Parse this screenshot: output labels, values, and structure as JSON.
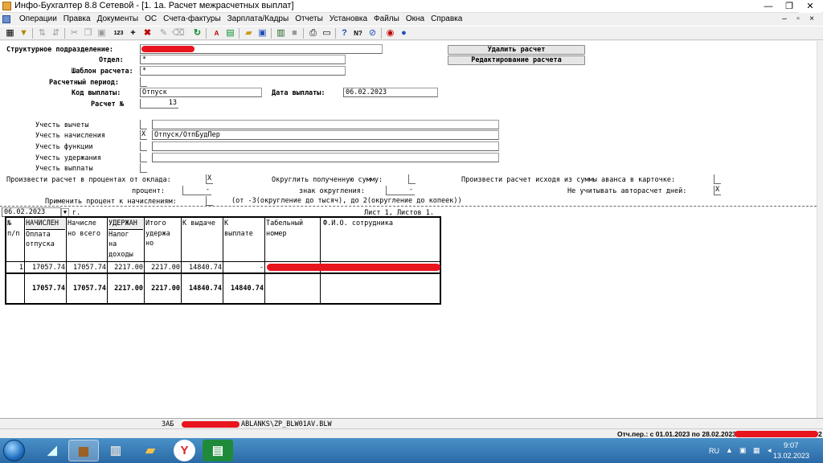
{
  "window": {
    "title": "Инфо-Бухгалтер 8.8 Сетевой - [1. 1а. Расчет межрасчетных выплат]",
    "minimize": "—",
    "restore": "❐",
    "close": "✕",
    "doc_minimize": "–",
    "doc_restore": "▫",
    "doc_close": "×"
  },
  "menu": {
    "items": [
      "Операции",
      "Правка",
      "Документы",
      "ОС",
      "Счета-фактуры",
      "Зарплата/Кадры",
      "Отчеты",
      "Установка",
      "Файлы",
      "Окна",
      "Справка"
    ]
  },
  "toolbar": {
    "icons": [
      "grid-icon",
      "filter-icon",
      "sort-icon",
      "sort-desc-icon",
      "cut-icon",
      "copy-icon",
      "paste-icon",
      "numbering-icon",
      "add-icon",
      "delete-icon",
      "clear-icon",
      "wipe-icon",
      "refresh-icon",
      "pdf-icon",
      "excel-icon",
      "open-folder-icon",
      "save-icon",
      "calculator-icon",
      "stop-icon",
      "print-icon",
      "preview-icon",
      "help-icon",
      "help-context-icon",
      "compass-icon",
      "lifebuoy-icon",
      "user-search-icon"
    ]
  },
  "form": {
    "structural_unit_label": "Структурное подразделение:",
    "department_label": "Отдел:",
    "department_value": "*",
    "template_label": "Шаблон расчета:",
    "template_value": "*",
    "period_label": "Расчетный период:",
    "payment_code_label": "Код выплаты:",
    "payment_code_value": "Отпуск",
    "payment_date_label": "Дата выплаты:",
    "payment_date_value": "06.02.2023",
    "calc_number_label": "Расчет №",
    "calc_number_value": "13",
    "delete_button": "Удалить расчет",
    "edit_button": "Редактирование расчета",
    "consider_deductions": "Учесть вычеты",
    "consider_accruals": "Учесть начисления",
    "accruals_flag": "X",
    "accruals_value": "Отпуск/ОтпБудПер",
    "consider_functions": "Учесть функции",
    "consider_withholdings": "Учесть удержания",
    "consider_payments": "Учесть выплаты",
    "percent_of_salary_label": "Произвести расчет в процентах от оклада:",
    "percent_of_salary_flag": "X",
    "round_sum_label": "Округлить полученную сумму:",
    "from_advance_label": "Произвести расчет исходя из суммы аванса в карточке:",
    "percent_label": "процент:",
    "percent_value": "-",
    "round_sign_label": "знак округления:",
    "round_sign_value": "-",
    "no_autocalc_label": "Не учитывать авторасчет дней:",
    "no_autocalc_flag": "X",
    "apply_percent_label": "Применить процент к начислениям:",
    "round_hint": "(от -3(округление до тысяч), до 2(округление до копеек))"
  },
  "report": {
    "date": "06.02.2023",
    "date_suffix": "г.",
    "sheet_info": "Лист 1, Листов 1.",
    "headers": {
      "num": [
        "№",
        "п/п"
      ],
      "accrued": [
        "НАЧИСЛЕН",
        "Оплата",
        "отпуска"
      ],
      "accrued_total": [
        "Начисле",
        "но всего"
      ],
      "withheld": [
        "УДЕРЖАН",
        "Налог",
        "на",
        "доходы"
      ],
      "withheld_total": [
        "Итого",
        "удержа",
        "но"
      ],
      "to_issue": [
        "К выдаче"
      ],
      "to_pay": [
        "К",
        "выплате"
      ],
      "tab_number": [
        "Табельный",
        "номер"
      ],
      "fio": [
        "Ф.И.О. сотрудника"
      ]
    },
    "rows": [
      {
        "num": "1",
        "accrued": "17057.74",
        "accrued_total": "17057.74",
        "withheld": "2217.00",
        "withheld_total": "2217.00",
        "to_issue": "14840.74",
        "to_pay": "-"
      }
    ],
    "totals": {
      "accrued": "17057.74",
      "accrued_total": "17057.74",
      "withheld": "2217.00",
      "withheld_total": "2217.00",
      "to_issue": "14840.74",
      "to_pay": "14840.74"
    }
  },
  "status": {
    "mode": "ЗАБ",
    "path": "ABLANKS\\ZP_BLW01AV.BLW",
    "period": "Отч.пер.: с 01.01.2023 по 28.02.2023",
    "suffix": "2"
  },
  "taskbar": {
    "language": "RU",
    "time": "9:07",
    "date": "13.02.2023",
    "yandex_label": "Y"
  }
}
